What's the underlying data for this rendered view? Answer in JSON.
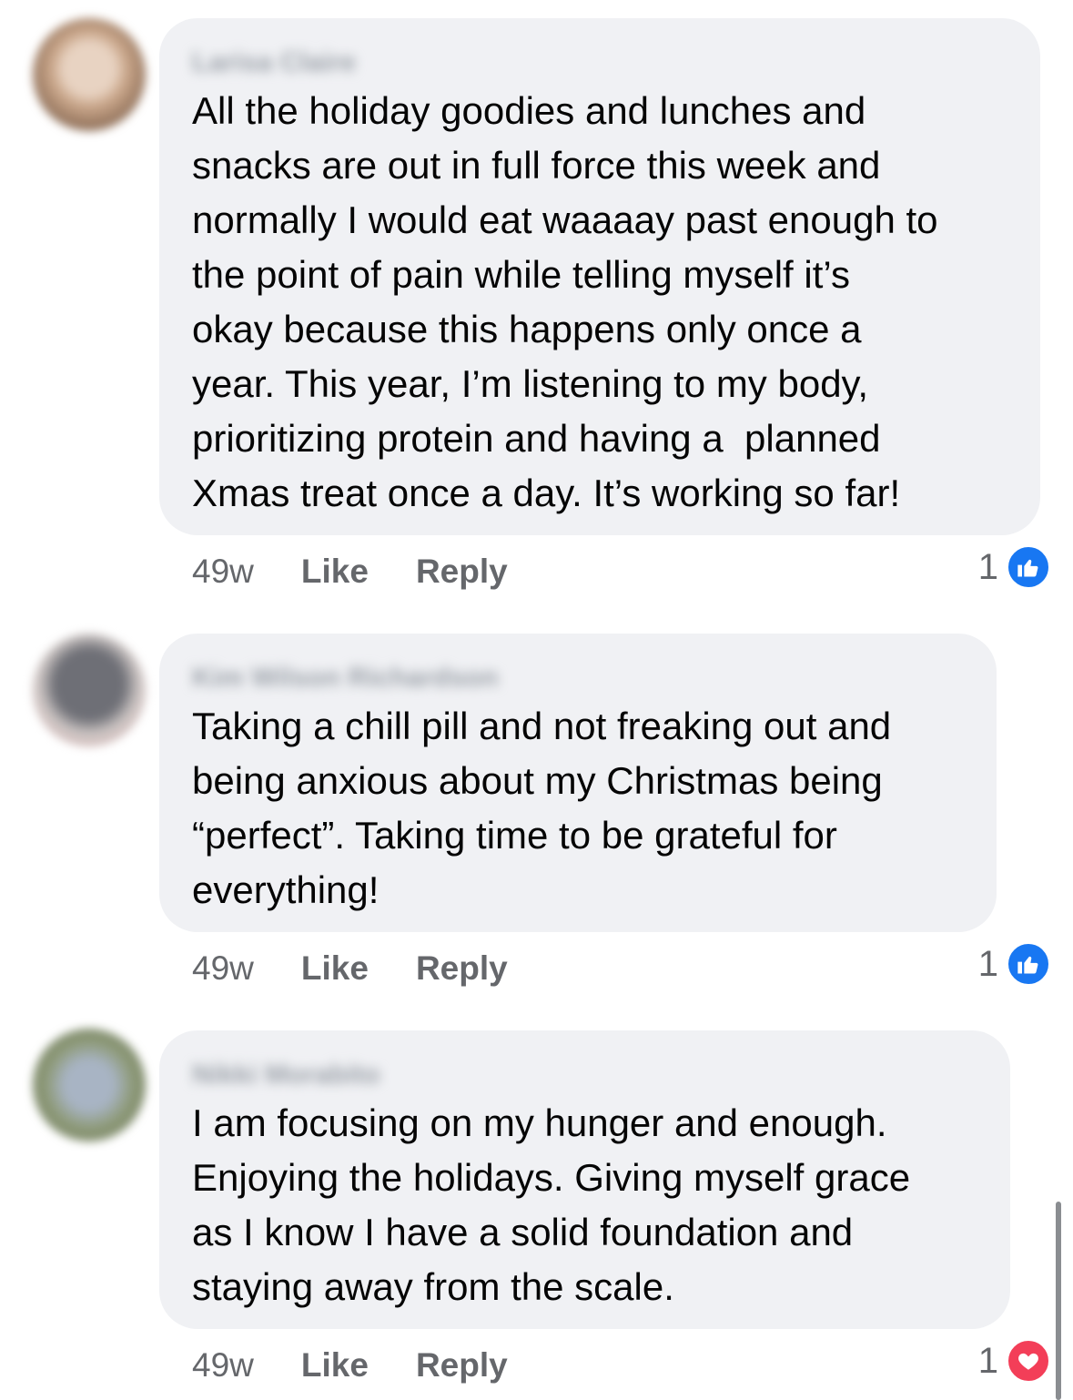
{
  "comments": [
    {
      "author": "Larisa Claire",
      "text": "All the holiday goodies and lunches and\nsnacks are out in full force this week and\nnormally I would eat waaaay past enough to\nthe point of pain while telling myself it’s\nokay because this happens only once a\nyear. This year, I’m listening to my body,\nprioritizing protein and having a  planned\nXmas treat once a day. It’s working so far!",
      "time": "49w",
      "like_label": "Like",
      "reply_label": "Reply",
      "reaction_count": "1",
      "reaction_icon": "thumbs-up-icon",
      "avatar_colors": [
        "#c9a68a",
        "#e8d3c2",
        "#8a6b55"
      ]
    },
    {
      "author": "Kim Wilson Richardson",
      "text": "Taking a chill pill and not freaking out and\nbeing anxious about my Christmas being\n“perfect”. Taking time to be grateful for\neverything!",
      "time": "49w",
      "like_label": "Like",
      "reply_label": "Reply",
      "reaction_count": "1",
      "reaction_icon": "thumbs-up-icon",
      "avatar_colors": [
        "#6e6f76",
        "#cfc8c6",
        "#d9a3a3"
      ]
    },
    {
      "author": "Nikki Morabito",
      "text": "I am focusing on my hunger and enough.\nEnjoying the holidays. Giving myself grace\nas I know I have a solid foundation and\nstaying away from the scale.",
      "time": "49w",
      "like_label": "Like",
      "reply_label": "Reply",
      "reaction_count": "1",
      "reaction_icon": "heart-icon",
      "avatar_colors": [
        "#8e9a78",
        "#a8b4c4",
        "#5f6b52"
      ]
    }
  ],
  "colors": {
    "bubble": "#f0f1f4",
    "like_blue": "#1877f2",
    "love_red": "#f33e58",
    "meta_gray": "#65676b"
  }
}
